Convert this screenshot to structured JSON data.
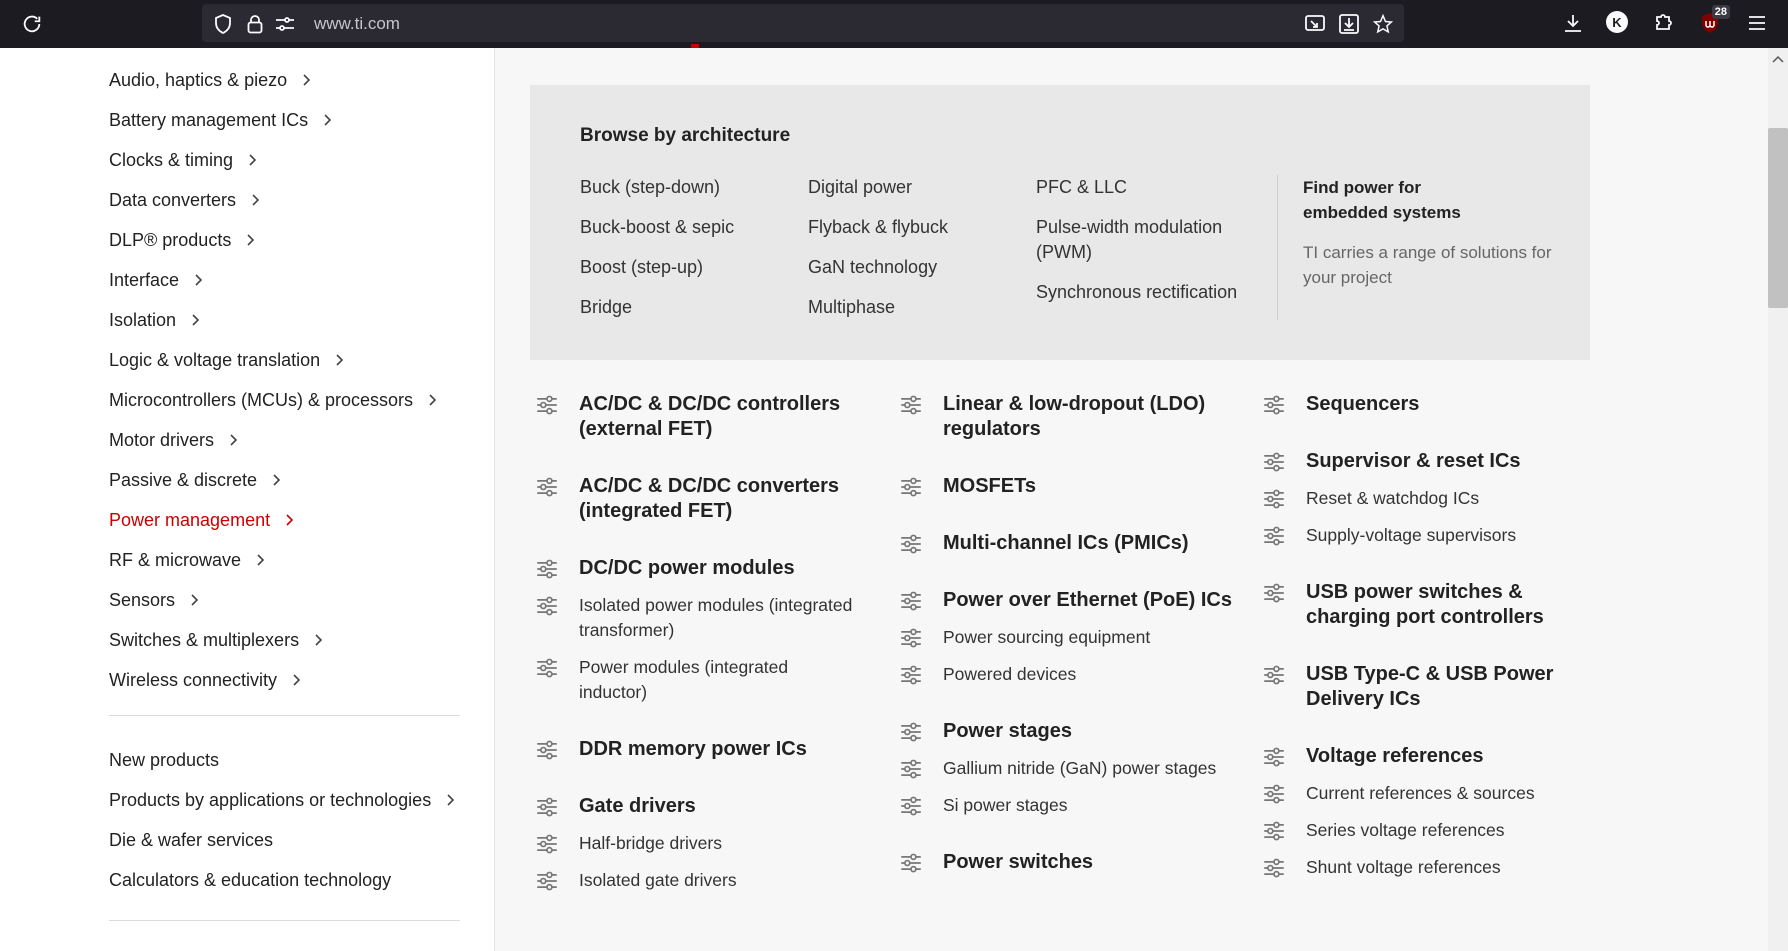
{
  "browser": {
    "url": "www.ti.com",
    "extension_badge": "28",
    "account_initial": "K"
  },
  "sidebar": {
    "items": [
      {
        "label": "Audio, haptics & piezo",
        "chevron": true
      },
      {
        "label": "Battery management ICs",
        "chevron": true
      },
      {
        "label": "Clocks & timing",
        "chevron": true
      },
      {
        "label": "Data converters",
        "chevron": true
      },
      {
        "label": "DLP® products",
        "chevron": true
      },
      {
        "label": "Interface",
        "chevron": true
      },
      {
        "label": "Isolation",
        "chevron": true
      },
      {
        "label": "Logic & voltage translation",
        "chevron": true
      },
      {
        "label": "Microcontrollers (MCUs) & processors",
        "chevron": true
      },
      {
        "label": "Motor drivers",
        "chevron": true
      },
      {
        "label": "Passive & discrete",
        "chevron": true
      },
      {
        "label": "Power management",
        "chevron": true,
        "active": true
      },
      {
        "label": "RF & microwave",
        "chevron": true
      },
      {
        "label": "Sensors",
        "chevron": true
      },
      {
        "label": "Switches & multiplexers",
        "chevron": true
      },
      {
        "label": "Wireless connectivity",
        "chevron": true
      }
    ],
    "secondary": [
      {
        "label": "New products",
        "chevron": false
      },
      {
        "label": "Products by applications or technologies",
        "chevron": true
      },
      {
        "label": "Die & wafer services",
        "chevron": false
      },
      {
        "label": "Calculators & education technology",
        "chevron": false
      }
    ]
  },
  "architecture": {
    "title": "Browse by architecture",
    "columns": [
      [
        "Buck (step-down)",
        "Buck-boost & sepic",
        "Boost (step-up)",
        "Bridge"
      ],
      [
        "Digital power",
        "Flyback & flybuck",
        "GaN technology",
        "Multiphase"
      ],
      [
        "PFC & LLC",
        "Pulse-width modulation (PWM)",
        "Synchronous rectification"
      ]
    ],
    "find_title": "Find power for embedded systems",
    "find_desc": "TI carries a range of solutions for your project"
  },
  "categories": {
    "col1": [
      {
        "label": "AC/DC & DC/DC controllers (external FET)",
        "heading": true
      },
      {
        "label": "AC/DC & DC/DC converters (integrated FET)",
        "heading": true
      },
      {
        "label": "DC/DC power modules",
        "heading": true
      },
      {
        "label": "Isolated power modules (integrated transformer)",
        "heading": false
      },
      {
        "label": "Power modules (integrated inductor)",
        "heading": false
      },
      {
        "label": "DDR memory power ICs",
        "heading": true
      },
      {
        "label": "Gate drivers",
        "heading": true
      },
      {
        "label": "Half-bridge drivers",
        "heading": false
      },
      {
        "label": "Isolated gate drivers",
        "heading": false
      }
    ],
    "col2": [
      {
        "label": "Linear & low-dropout (LDO) regulators",
        "heading": true
      },
      {
        "label": "MOSFETs",
        "heading": true
      },
      {
        "label": "Multi-channel ICs (PMICs)",
        "heading": true
      },
      {
        "label": "Power over Ethernet (PoE) ICs",
        "heading": true
      },
      {
        "label": "Power sourcing equipment",
        "heading": false
      },
      {
        "label": "Powered devices",
        "heading": false
      },
      {
        "label": "Power stages",
        "heading": true
      },
      {
        "label": "Gallium nitride (GaN) power stages",
        "heading": false
      },
      {
        "label": "Si power stages",
        "heading": false
      },
      {
        "label": "Power switches",
        "heading": true
      }
    ],
    "col3": [
      {
        "label": "Sequencers",
        "heading": true
      },
      {
        "label": "Supervisor & reset ICs",
        "heading": true
      },
      {
        "label": "Reset & watchdog ICs",
        "heading": false
      },
      {
        "label": "Supply-voltage supervisors",
        "heading": false
      },
      {
        "label": "USB power switches & charging port controllers",
        "heading": true
      },
      {
        "label": "USB Type-C & USB Power Delivery ICs",
        "heading": true
      },
      {
        "label": "Voltage references",
        "heading": true
      },
      {
        "label": "Current references & sources",
        "heading": false
      },
      {
        "label": "Series voltage references",
        "heading": false
      },
      {
        "label": "Shunt voltage references",
        "heading": false
      }
    ]
  }
}
